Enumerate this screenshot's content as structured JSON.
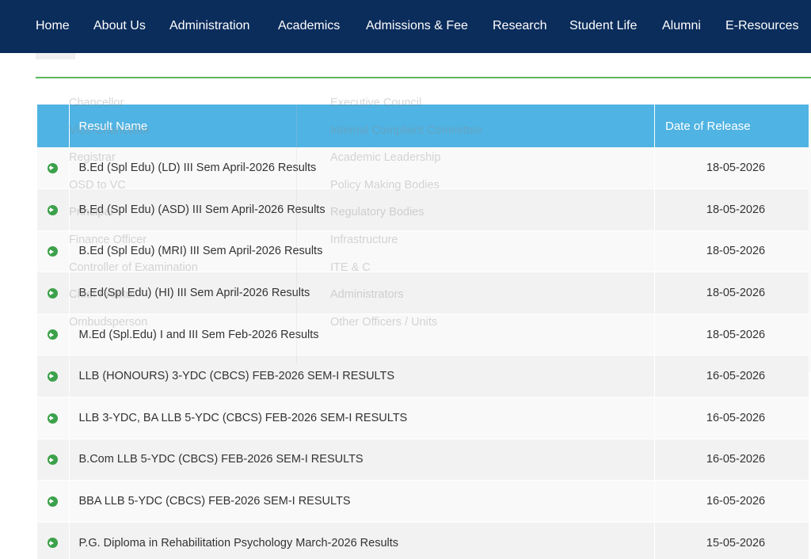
{
  "nav": {
    "items": [
      {
        "label": "Home",
        "name": "nav-home"
      },
      {
        "label": "About Us",
        "name": "nav-about-us"
      },
      {
        "label": "Administration",
        "name": "nav-administration"
      },
      {
        "label": "Academics",
        "name": "nav-academics"
      },
      {
        "label": "Admissions & Fee",
        "name": "nav-admissions-fee"
      },
      {
        "label": "Research",
        "name": "nav-research"
      },
      {
        "label": "Student Life",
        "name": "nav-student-life"
      },
      {
        "label": "Alumni",
        "name": "nav-alumni"
      },
      {
        "label": "E-Resources",
        "name": "nav-e-resources"
      }
    ]
  },
  "dropdown": {
    "left_column": [
      "Chancellor",
      "Vice-Chancellor",
      "Registrar",
      "OSD to VC",
      "Principal",
      "Finance Officer",
      "Controller of Examination",
      "Chief Proctor",
      "Ombudsperson"
    ],
    "right_column": [
      "Executive Council",
      "Internal Complaint Committee",
      "Academic Leadership",
      "Policy Making Bodies",
      "Regulatory Bodies",
      "Infrastructure",
      "ITE & C",
      "Administrators",
      "Other Officers / Units"
    ]
  },
  "table": {
    "header_name": "Result Name",
    "header_date": "Date of Release",
    "rows": [
      {
        "name": "B.Ed (Spl Edu) (LD) III Sem April-2026 Results",
        "date": "18-05-2026"
      },
      {
        "name": "B.Ed (Spl Edu) (ASD) III Sem April-2026 Results",
        "date": "18-05-2026"
      },
      {
        "name": "B.Ed (Spl Edu) (MRI) III Sem April-2026 Results",
        "date": "18-05-2026"
      },
      {
        "name": "B.Ed(Spl Edu) (HI) III Sem April-2026 Results",
        "date": "18-05-2026"
      },
      {
        "name": "M.Ed (Spl.Edu) I and III Sem Feb-2026 Results",
        "date": "18-05-2026"
      },
      {
        "name": "LLB (HONOURS) 3-YDC (CBCS) FEB-2026 SEM-I RESULTS",
        "date": "16-05-2026"
      },
      {
        "name": "LLB 3-YDC, BA LLB 5-YDC (CBCS) FEB-2026 SEM-I RESULTS",
        "date": "16-05-2026"
      },
      {
        "name": "B.Com LLB 5-YDC (CBCS) FEB-2026 SEM-I RESULTS",
        "date": "16-05-2026"
      },
      {
        "name": "BBA LLB 5-YDC (CBCS) FEB-2026 SEM-I RESULTS",
        "date": "16-05-2026"
      },
      {
        "name": "P.G. Diploma in Rehabilitation Psychology March-2026 Results",
        "date": "15-05-2026"
      }
    ]
  },
  "colors": {
    "nav_bg": "#0b2d5c",
    "header_bg": "#4fb3e3",
    "accent_green": "#3ca14a",
    "rule_green": "#5cb85c"
  }
}
